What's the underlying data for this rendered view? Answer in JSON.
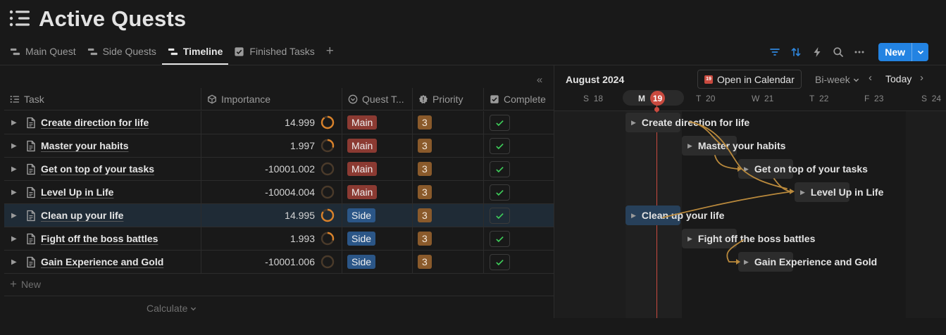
{
  "page": {
    "title": "Active Quests"
  },
  "tabs": [
    {
      "label": "Main Quest",
      "icon": "timeline-icon",
      "active": false
    },
    {
      "label": "Side Quests",
      "icon": "timeline-icon",
      "active": false
    },
    {
      "label": "Timeline",
      "icon": "timeline-icon",
      "active": true
    },
    {
      "label": "Finished Tasks",
      "icon": "checkbox-icon",
      "active": false
    }
  ],
  "toolbar": {
    "new_label": "New"
  },
  "columns": {
    "task": "Task",
    "importance": "Importance",
    "quest_type": "Quest T...",
    "priority": "Priority",
    "complete": "Complete"
  },
  "rows": [
    {
      "name": "Create direction for life",
      "importance": "14.999",
      "ring": 0.9,
      "quest_type": "Main",
      "priority": "3",
      "complete": true
    },
    {
      "name": "Master your habits",
      "importance": "1.997",
      "ring": 0.3,
      "quest_type": "Main",
      "priority": "3",
      "complete": true
    },
    {
      "name": "Get on top of your tasks",
      "importance": "-10001.002",
      "ring": 0,
      "quest_type": "Main",
      "priority": "3",
      "complete": true
    },
    {
      "name": "Level Up in Life",
      "importance": "-10004.004",
      "ring": 0,
      "quest_type": "Main",
      "priority": "3",
      "complete": true
    },
    {
      "name": "Clean up your life",
      "importance": "14.995",
      "ring": 0.85,
      "quest_type": "Side",
      "priority": "3",
      "complete": true
    },
    {
      "name": "Fight off the boss battles",
      "importance": "1.993",
      "ring": 0.3,
      "quest_type": "Side",
      "priority": "3",
      "complete": true
    },
    {
      "name": "Gain Experience and Gold",
      "importance": "-10001.006",
      "ring": 0,
      "quest_type": "Side",
      "priority": "3",
      "complete": true
    }
  ],
  "new_row_label": "New",
  "calculate_label": "Calculate",
  "colors": {
    "main": "#8b3a32",
    "side": "#2b5687",
    "accent": "#2383e2",
    "today": "#c94a3f",
    "ring_fill": "#d9822b",
    "dependency": "#b9893c"
  },
  "timeline": {
    "month": "August 2024",
    "open_calendar": "Open in Calendar",
    "calendar_icon_day": "19",
    "range": "Bi-week",
    "today_label": "Today",
    "today_day": "19",
    "days": [
      {
        "letter": "S",
        "num": "18"
      },
      {
        "letter": "M",
        "num": "19"
      },
      {
        "letter": "T",
        "num": "20"
      },
      {
        "letter": "W",
        "num": "21"
      },
      {
        "letter": "T",
        "num": "22"
      },
      {
        "letter": "F",
        "num": "23"
      },
      {
        "letter": "S",
        "num": "24"
      }
    ]
  }
}
